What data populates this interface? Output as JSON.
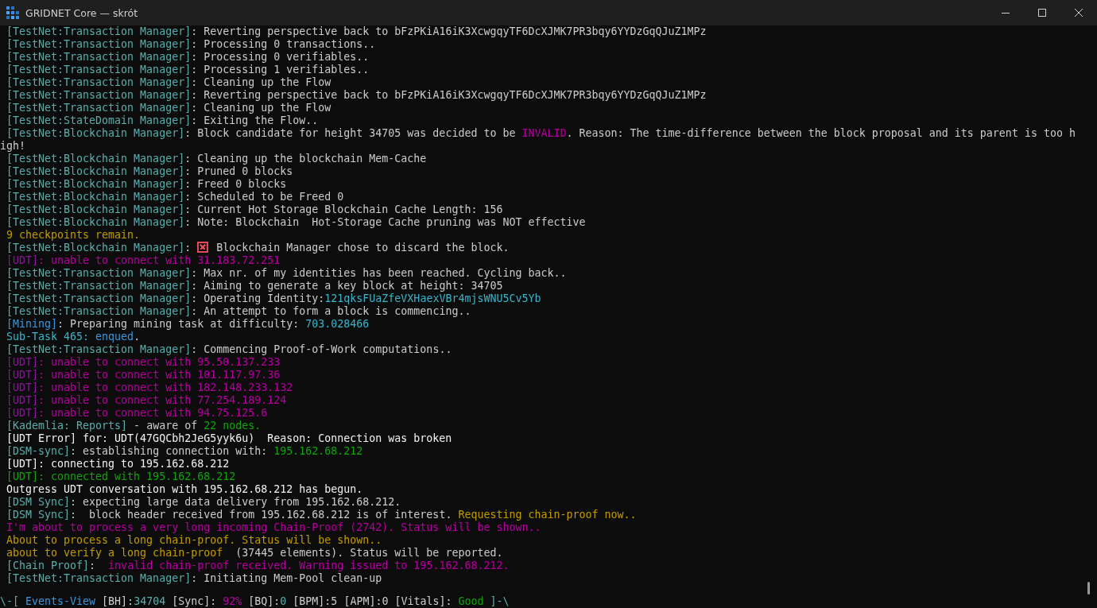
{
  "window": {
    "title": "GRIDNET Core — skrót"
  },
  "lines": [
    {
      "segments": [
        {
          "text": "[TestNet:Transaction Manager]",
          "color": "#5aaeae"
        },
        {
          "text": ": Reverting perspective back to bFzPKiA16iK3XcwgqyTF6DcXJMK7PR3bqy6YYDzGqQJuZ1MPz",
          "color": "#cccccc"
        }
      ]
    },
    {
      "segments": [
        {
          "text": "[TestNet:Transaction Manager]",
          "color": "#5aaeae"
        },
        {
          "text": ": Processing 0 transactions..",
          "color": "#cccccc"
        }
      ]
    },
    {
      "segments": [
        {
          "text": "[TestNet:Transaction Manager]",
          "color": "#5aaeae"
        },
        {
          "text": ": Processing 0 verifiables..",
          "color": "#cccccc"
        }
      ]
    },
    {
      "segments": [
        {
          "text": "[TestNet:Transaction Manager]",
          "color": "#5aaeae"
        },
        {
          "text": ": Processing 1 verifiables..",
          "color": "#cccccc"
        }
      ]
    },
    {
      "segments": [
        {
          "text": "[TestNet:Transaction Manager]",
          "color": "#5aaeae"
        },
        {
          "text": ": Cleaning up the Flow",
          "color": "#cccccc"
        }
      ]
    },
    {
      "segments": [
        {
          "text": "[TestNet:Transaction Manager]",
          "color": "#5aaeae"
        },
        {
          "text": ": Reverting perspective back to bFzPKiA16iK3XcwgqyTF6DcXJMK7PR3bqy6YYDzGqQJuZ1MPz",
          "color": "#cccccc"
        }
      ]
    },
    {
      "segments": [
        {
          "text": "[TestNet:Transaction Manager]",
          "color": "#5aaeae"
        },
        {
          "text": ": Cleaning up the Flow",
          "color": "#cccccc"
        }
      ]
    },
    {
      "segments": [
        {
          "text": "[TestNet:StateDomain Manager]",
          "color": "#5aaeae"
        },
        {
          "text": ": Exiting the Flow..",
          "color": "#cccccc"
        }
      ]
    },
    {
      "segments": [
        {
          "text": "[TestNet:Blockchain Manager]",
          "color": "#5aaeae"
        },
        {
          "text": ": Block candidate for height 34705 was decided to be ",
          "color": "#cccccc"
        },
        {
          "text": "INVALID",
          "color": "#b4009e"
        },
        {
          "text": ". Reason: The time-difference between the block proposal and its parent is too high!",
          "color": "#cccccc"
        }
      ]
    },
    {
      "segments": [
        {
          "text": "[TestNet:Blockchain Manager]",
          "color": "#5aaeae"
        },
        {
          "text": ": Cleaning up the blockchain Mem-Cache",
          "color": "#cccccc"
        }
      ]
    },
    {
      "segments": [
        {
          "text": "[TestNet:Blockchain Manager]",
          "color": "#5aaeae"
        },
        {
          "text": ": Pruned 0 blocks",
          "color": "#cccccc"
        }
      ]
    },
    {
      "segments": [
        {
          "text": "[TestNet:Blockchain Manager]",
          "color": "#5aaeae"
        },
        {
          "text": ": Freed 0 blocks",
          "color": "#cccccc"
        }
      ]
    },
    {
      "segments": [
        {
          "text": "[TestNet:Blockchain Manager]",
          "color": "#5aaeae"
        },
        {
          "text": ": Scheduled to be Freed 0",
          "color": "#cccccc"
        }
      ]
    },
    {
      "segments": [
        {
          "text": "[TestNet:Blockchain Manager]",
          "color": "#5aaeae"
        },
        {
          "text": ": Current Hot Storage Blockchain Cache Length: 156",
          "color": "#cccccc"
        }
      ]
    },
    {
      "segments": [
        {
          "text": "[TestNet:Blockchain Manager]",
          "color": "#5aaeae"
        },
        {
          "text": ": Note: Blockchain  Hot-Storage Cache pruning was NOT effective",
          "color": "#cccccc"
        }
      ]
    },
    {
      "segments": [
        {
          "text": "9 checkpoints remain.",
          "color": "#c19c00"
        }
      ]
    },
    {
      "segments": [
        {
          "text": "[TestNet:Blockchain Manager]",
          "color": "#5aaeae"
        },
        {
          "text": ": ",
          "color": "#cccccc"
        },
        {
          "kind": "cross-icon",
          "color": "#e74856"
        },
        {
          "text": " Blockchain Manager chose to discard the block.",
          "color": "#cccccc"
        }
      ]
    },
    {
      "segments": [
        {
          "text": "[UDT]",
          "color": "#881798"
        },
        {
          "text": ": unable to connect with 31.183.72.251",
          "color": "#b4009e"
        }
      ]
    },
    {
      "segments": [
        {
          "text": "[TestNet:Transaction Manager]",
          "color": "#5aaeae"
        },
        {
          "text": ": Max nr. of my identities has been reached. Cycling back..",
          "color": "#cccccc"
        }
      ]
    },
    {
      "segments": [
        {
          "text": "[TestNet:Transaction Manager]",
          "color": "#5aaeae"
        },
        {
          "text": ": Aiming to generate a key block at height: 34705",
          "color": "#cccccc"
        }
      ]
    },
    {
      "segments": [
        {
          "text": "[TestNet:Transaction Manager]",
          "color": "#5aaeae"
        },
        {
          "text": ": Operating Identity:",
          "color": "#cccccc"
        },
        {
          "text": "121qksFUaZfeVXHaexVBr4mjsWNU5Cv5Yb",
          "color": "#3ab4c8"
        }
      ]
    },
    {
      "segments": [
        {
          "text": "[TestNet:Transaction Manager]",
          "color": "#5aaeae"
        },
        {
          "text": ": An attempt to form a block is commencing..",
          "color": "#cccccc"
        }
      ]
    },
    {
      "segments": [
        {
          "text": "[Mining]",
          "color": "#3a96dd"
        },
        {
          "text": ": Preparing mining task at difficulty: ",
          "color": "#cccccc"
        },
        {
          "text": "703.028466",
          "color": "#3ab4c8"
        }
      ]
    },
    {
      "segments": [
        {
          "text": "Sub-Task 465: ",
          "color": "#3ab4c8"
        },
        {
          "text": "enqued",
          "color": "#3a96dd"
        },
        {
          "text": "."
        }
      ]
    },
    {
      "segments": [
        {
          "text": "[TestNet:Transaction Manager]",
          "color": "#5aaeae"
        },
        {
          "text": ": Commencing Proof-of-Work computations..",
          "color": "#cccccc"
        }
      ]
    },
    {
      "segments": [
        {
          "text": "[UDT]",
          "color": "#881798"
        },
        {
          "text": ": unable to connect with 95.50.137.233",
          "color": "#b4009e"
        }
      ]
    },
    {
      "segments": [
        {
          "text": "[UDT]",
          "color": "#881798"
        },
        {
          "text": ": unable to connect with 101.117.97.36",
          "color": "#b4009e"
        }
      ]
    },
    {
      "segments": [
        {
          "text": "[UDT]",
          "color": "#881798"
        },
        {
          "text": ": unable to connect with 182.148.233.132",
          "color": "#b4009e"
        }
      ]
    },
    {
      "segments": [
        {
          "text": "[UDT]",
          "color": "#881798"
        },
        {
          "text": ": unable to connect with 77.254.189.124",
          "color": "#b4009e"
        }
      ]
    },
    {
      "segments": [
        {
          "text": "[UDT]",
          "color": "#881798"
        },
        {
          "text": ": unable to connect with 94.75.125.6",
          "color": "#b4009e"
        }
      ]
    },
    {
      "segments": [
        {
          "text": "[Kademlia: Reports]",
          "color": "#5aaeae"
        },
        {
          "text": " - aware of ",
          "color": "#cccccc"
        },
        {
          "text": "22 nodes.",
          "color": "#13a10e"
        }
      ]
    },
    {
      "segments": [
        {
          "text": "[UDT Error] for: UDT(47GQCbh2JeG5yyk6u)  Reason: Connection was broken",
          "color": "#f2f2f2"
        }
      ]
    },
    {
      "segments": [
        {
          "text": "[DSM-sync]",
          "color": "#5aaeae"
        },
        {
          "text": ": establishing connection with: ",
          "color": "#cccccc"
        },
        {
          "text": "195.162.68.212",
          "color": "#13a10e"
        }
      ]
    },
    {
      "segments": [
        {
          "text": "[UDT]: connecting to 195.162.68.212",
          "color": "#f2f2f2"
        }
      ]
    },
    {
      "segments": [
        {
          "text": "[UDT]: connected with 195.162.68.212",
          "color": "#13a10e"
        }
      ]
    },
    {
      "segments": [
        {
          "text": "Outgress UDT conversation with 195.162.68.212 has begun.",
          "color": "#f2f2f2"
        }
      ]
    },
    {
      "segments": [
        {
          "text": "[DSM Sync]",
          "color": "#5aaeae"
        },
        {
          "text": ": expecting large data delivery from 195.162.68.212.",
          "color": "#cccccc"
        }
      ]
    },
    {
      "segments": [
        {
          "text": "[DSM Sync]",
          "color": "#5aaeae"
        },
        {
          "text": ":  block header received from 195.162.68.212 is of interest. ",
          "color": "#cccccc"
        },
        {
          "text": "Requesting chain-proof now..",
          "color": "#c19c00"
        }
      ]
    },
    {
      "segments": [
        {
          "text": "I'm about to process a very long incoming Chain-Proof (2742). Status will be shown..",
          "color": "#b4009e"
        }
      ]
    },
    {
      "segments": [
        {
          "text": "About to process a long chain-proof. Status will be shown..",
          "color": "#c19c00"
        }
      ]
    },
    {
      "segments": [
        {
          "text": "about to verify a long chain-proof",
          "color": "#c19c00"
        },
        {
          "text": "  (37445 elements). Status will be reported.",
          "color": "#cccccc"
        }
      ]
    },
    {
      "segments": [
        {
          "text": "[Chain Proof]",
          "color": "#5aaeae"
        },
        {
          "text": ":  "
        },
        {
          "text": "invalid chain-proof received. Warning issued to 195.162.68.212.",
          "color": "#b4009e"
        }
      ]
    },
    {
      "segments": [
        {
          "text": "[TestNet:Transaction Manager]",
          "color": "#5aaeae"
        },
        {
          "text": ": Initiating Mem-Pool clean-up",
          "color": "#cccccc"
        }
      ]
    }
  ],
  "status_bar": {
    "segments": [
      {
        "text": "\\-[ ",
        "color": "#5aaeae"
      },
      {
        "text": "Events-View",
        "color": "#3a96dd"
      },
      {
        "text": " [BH]:",
        "color": "#cccccc"
      },
      {
        "text": "34704",
        "color": "#5aaeae"
      },
      {
        "text": " [Sync]: ",
        "color": "#cccccc"
      },
      {
        "text": "92%",
        "color": "#b4009e"
      },
      {
        "text": " [BQ]:",
        "color": "#cccccc"
      },
      {
        "text": "0",
        "color": "#5aaeae"
      },
      {
        "text": " [BPM]:5 [APM]:0 [Vitals]: ",
        "color": "#cccccc"
      },
      {
        "text": "Good",
        "color": "#13a10e"
      },
      {
        "text": " ]-\\",
        "color": "#5aaeae"
      }
    ]
  }
}
